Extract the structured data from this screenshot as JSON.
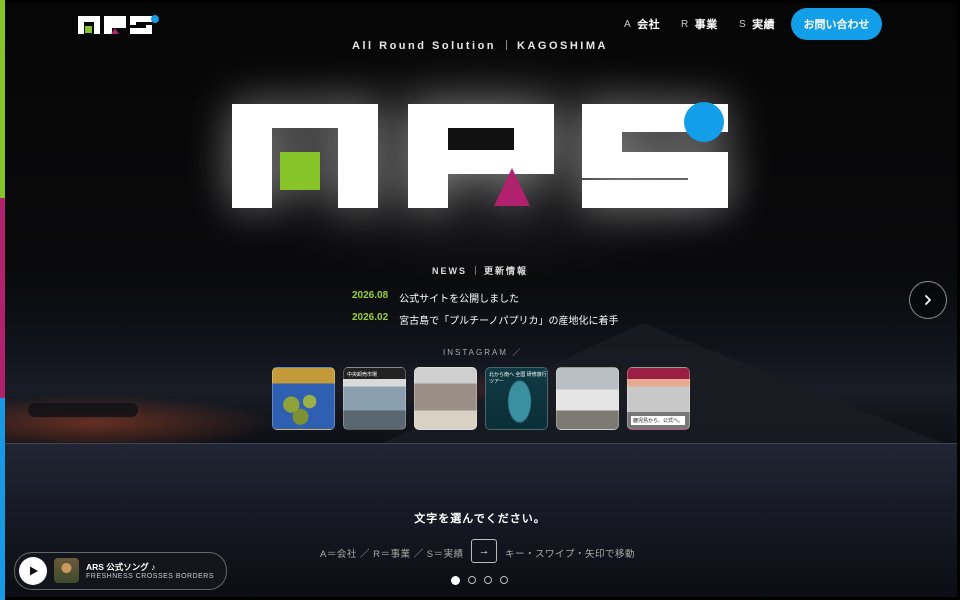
{
  "brand": {
    "name": "ARS",
    "tagline": "All Round Solution",
    "location": "KAGOSHIMA",
    "colors": {
      "green": "#86c42a",
      "magenta": "#b0226e",
      "blue": "#179ae3",
      "white": "#ffffff"
    }
  },
  "nav": [
    {
      "letter": "A",
      "label": "会社"
    },
    {
      "letter": "R",
      "label": "事業"
    },
    {
      "letter": "S",
      "label": "実績"
    }
  ],
  "contact": {
    "label": "お問い合わせ"
  },
  "news": {
    "heading": "NEWS",
    "heading_jp": "更新情報",
    "items": [
      {
        "date": "2026.08",
        "title": "公式サイトを公開しました"
      },
      {
        "date": "2026.02",
        "title": "宮古島で「プルチーノパプリカ」の産地化に着手"
      }
    ]
  },
  "instagram": {
    "heading": "INSTAGRAM ／",
    "posts": [
      {
        "caption": ""
      },
      {
        "caption": "中央卸売市場"
      },
      {
        "caption": ""
      },
      {
        "caption": "北から南へ 全国 研修旅行ツアー"
      },
      {
        "caption": ""
      },
      {
        "caption": "鹿児島から、公式へ。"
      }
    ]
  },
  "instructions": {
    "prompt": "文字を選んでください。",
    "legend": "A＝会社 ／ R＝事業 ／ S＝実績",
    "key": "→",
    "hint": "キー・スワイプ・矢印で移動"
  },
  "carousel": {
    "total": 4,
    "active": 1
  },
  "player": {
    "title": "ARS 公式ソング ♪",
    "subtitle": "FRESHNESS CROSSES BORDERS"
  },
  "icons": {
    "next": "chevron-right-icon",
    "play": "play-icon",
    "key": "arrow-right-icon"
  }
}
